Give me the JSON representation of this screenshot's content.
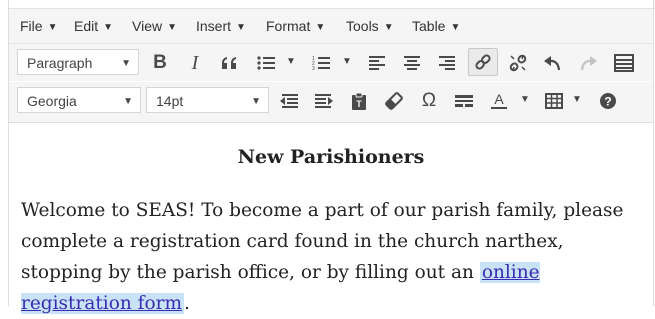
{
  "menus": [
    "File",
    "Edit",
    "View",
    "Insert",
    "Format",
    "Tools",
    "Table"
  ],
  "toolbar": {
    "block_format": "Paragraph",
    "font_family": "Georgia",
    "font_size": "14pt",
    "bold_glyph": "B",
    "italic_glyph": "I",
    "omega_glyph": "Ω"
  },
  "document": {
    "title": "New Parishioners",
    "body_text": "Welcome to SEAS! To become a part of our parish family, please complete a registration card found in the church narthex, stopping by the parish office, or by filling out an ",
    "link_text": "online registration form",
    "body_end": "."
  },
  "colors": {
    "link": "#3a2bb0",
    "link_highlight": "#c8e3f8",
    "toolbar_bg": "#f5f5f5"
  },
  "icons": [
    "bold-icon",
    "italic-icon",
    "blockquote-icon",
    "bullet-list-icon",
    "numbered-list-icon",
    "align-left-icon",
    "align-center-icon",
    "align-right-icon",
    "link-icon",
    "unlink-icon",
    "undo-icon",
    "redo-icon",
    "toolbar-toggle-icon",
    "outdent-icon",
    "indent-icon",
    "paste-as-text-icon",
    "clear-formatting-icon",
    "special-character-icon",
    "horizontal-line-icon",
    "text-color-icon",
    "table-icon",
    "help-icon"
  ]
}
